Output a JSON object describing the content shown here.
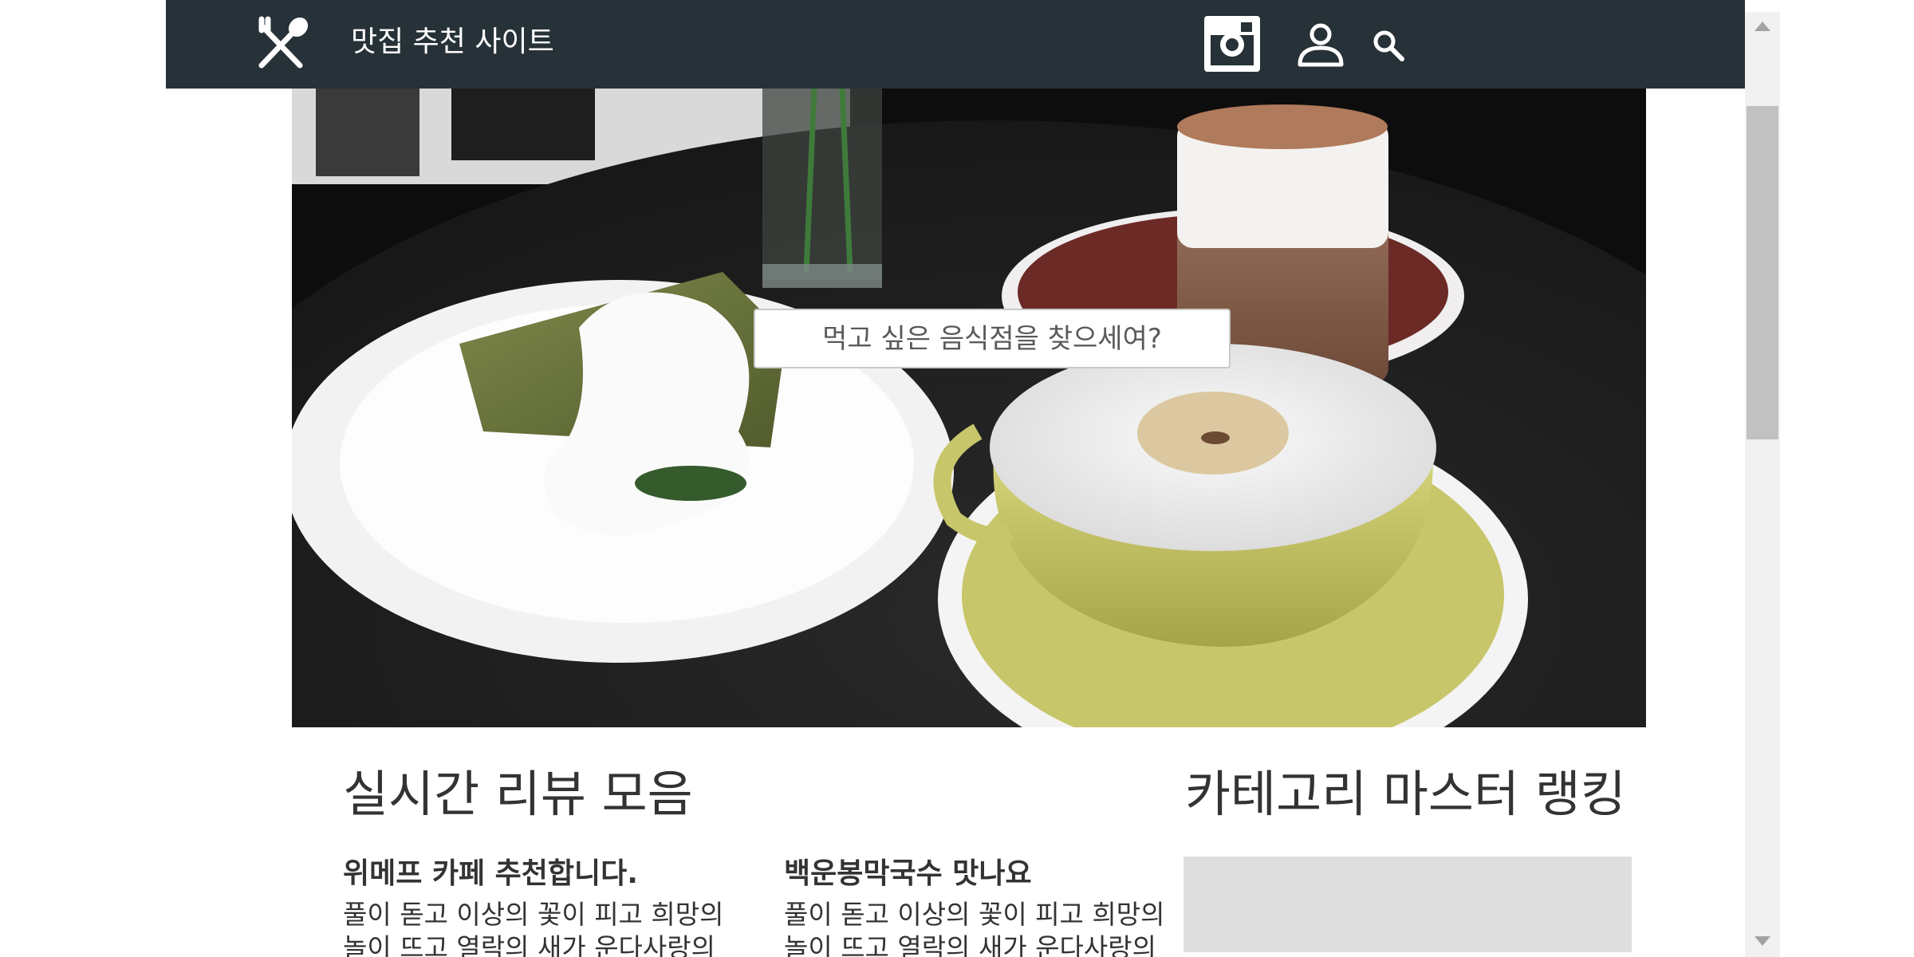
{
  "header": {
    "logo_icon": "fork-spoon-icon",
    "title": "맛집 추천 사이트",
    "background": "#263238",
    "icons": [
      "instagram-icon",
      "user-icon",
      "search-icon"
    ]
  },
  "hero": {
    "image": "cafe-desserts-photo",
    "search_placeholder": "먹고 싶은 음식점을 찾으세여?"
  },
  "reviews": {
    "title": "실시간 리뷰 모음",
    "items": [
      {
        "title": "위메프 카페 추천합니다.",
        "body": "풀이 돋고 이상의 꽃이 피고 희망의 놀이 뜨고 열락의 새가 운다사랑의"
      },
      {
        "title": "백운봉막국수 맛나요",
        "body": "풀이 돋고 이상의 꽃이 피고 희망의 놀이 뜨고 열락의 새가 운다사랑의"
      }
    ]
  },
  "ranking": {
    "title": "카테고리 마스터 랭킹"
  }
}
